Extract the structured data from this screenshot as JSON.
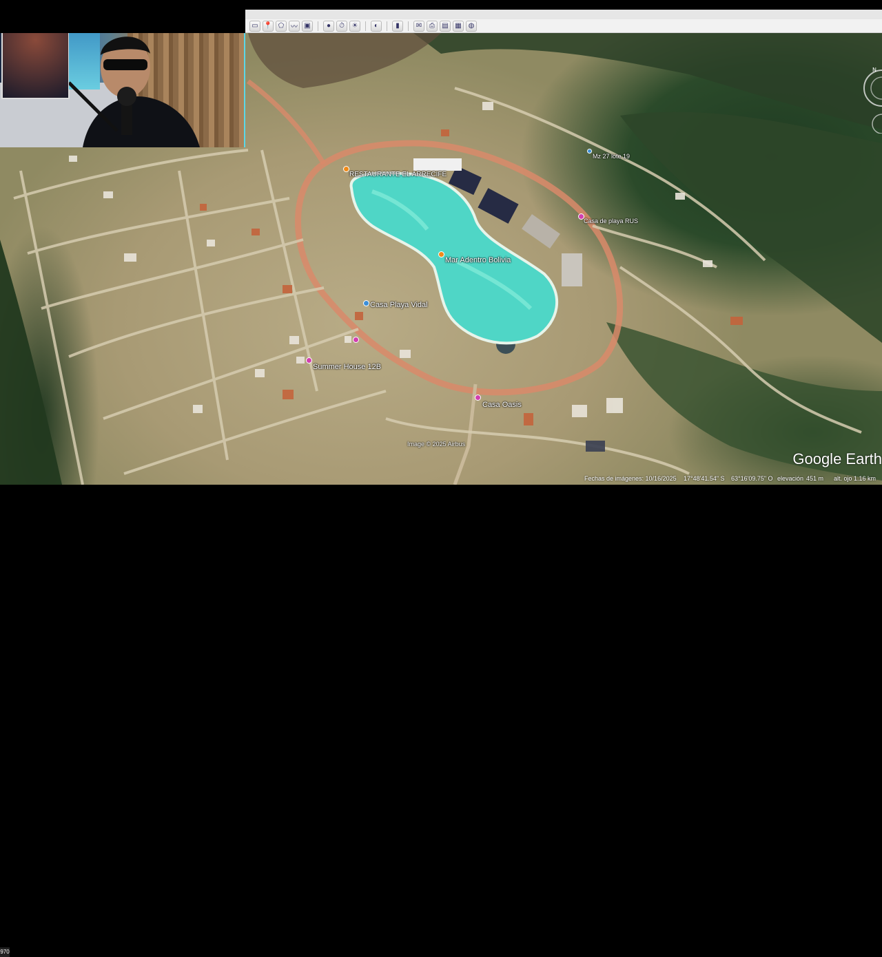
{
  "map": {
    "labels": {
      "restaurant": "RESTAURANTE EL ARRECIFE",
      "mar_adentro": "Mar Adentro Bolivia",
      "casa_playa_vidal": "Casa Playa Vidal",
      "summer_house": "Summer House 12B",
      "casa_oasis": "Casa Oasis",
      "casa_playa_rus": "Casa de playa RUS",
      "mz_lote": "Mz 27 lote 19",
      "image_credit": "Image © 2025 Airbus"
    },
    "brand": "Google Earth",
    "status": {
      "imagery_date": "Fechas de imágenes: 10/16/2025",
      "lat": "17°48'41.54\" S",
      "lon": "63°16'09.75\" O",
      "elevation_label": "elevación",
      "elevation_value": "451 m",
      "eye_alt": "alt. ojo  1.16 km",
      "left_badge": "970"
    },
    "colors": {
      "lake": "#4fd6c6",
      "roads": "#d98a6a",
      "forest": "#233a22"
    }
  },
  "toolbar": {
    "icons": [
      "hide-sidebar-icon",
      "placemark-icon",
      "polygon-icon",
      "path-icon",
      "overlay-icon",
      "record-tour-icon",
      "historical-imagery-icon",
      "sun-icon",
      "planets-icon",
      "ruler-icon",
      "email-icon",
      "print-icon",
      "save-image-icon",
      "view-in-maps-icon"
    ]
  }
}
